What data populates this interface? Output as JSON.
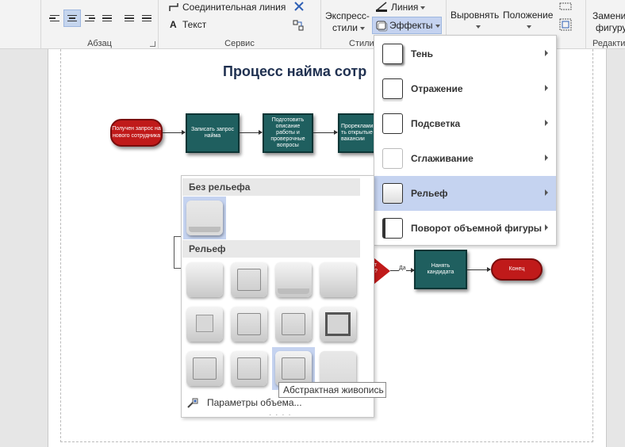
{
  "ribbon": {
    "groups": {
      "paragraph": "Абзац",
      "service": "Сервис",
      "styles": "Стили",
      "edit": "Редакти"
    },
    "service": {
      "connector": "Соединительная линия",
      "text": "Текст"
    },
    "styles": {
      "express": "Экспресс-",
      "express2": "стили",
      "line": "Линия",
      "effects": "Эффекты"
    },
    "arrange": {
      "align": "Выровнять",
      "position": "Положение"
    },
    "edit": {
      "replace": "Замени",
      "replace2": "фигуру"
    }
  },
  "document": {
    "title": "Процесс найма сотр",
    "shapes": {
      "start": "Получен запрос на нового сотрудника",
      "step1": "Записать запрос найма",
      "step2": "Подготовить описание работы и проверочные вопросы",
      "step3": "Прорекламирова ть открытые вакансии",
      "decision_partial": "т\n?",
      "yes_label": "Да",
      "hire": "Нанять кандидата",
      "end": "Конец"
    }
  },
  "effects_menu": {
    "items": [
      {
        "label": "Тень"
      },
      {
        "label": "Отражение"
      },
      {
        "label": "Подсветка"
      },
      {
        "label": "Сглаживание"
      },
      {
        "label": "Рельеф"
      },
      {
        "label": "Поворот объемной фигуры"
      }
    ],
    "highlighted": "Рельеф"
  },
  "relief_gallery": {
    "no_relief_header": "Без рельефа",
    "relief_header": "Рельеф",
    "footer": "Параметры объема...",
    "selected_index": 10,
    "tooltip": "Абстрактная живопись"
  }
}
